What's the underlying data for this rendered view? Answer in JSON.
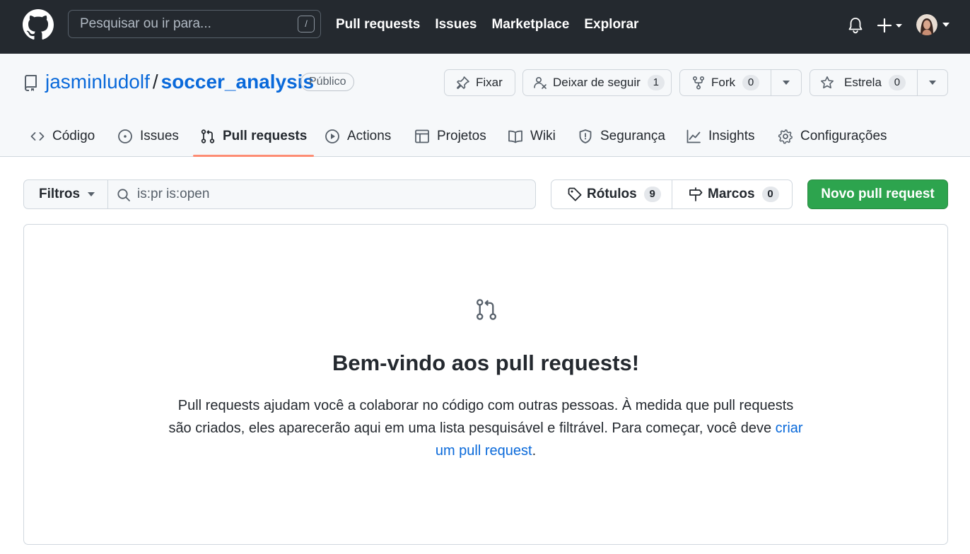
{
  "header": {
    "search_placeholder": "Pesquisar ou ir para...",
    "search_shortcut": "/",
    "nav": [
      "Pull requests",
      "Issues",
      "Marketplace",
      "Explorar"
    ]
  },
  "repo": {
    "owner": "jasminludolf",
    "separator": "/",
    "name": "soccer_analysis",
    "visibility": "Público",
    "actions": {
      "pin_label": "Fixar",
      "unwatch_label": "Deixar de seguir",
      "watch_count": "1",
      "fork_label": "Fork",
      "fork_count": "0",
      "star_label": "Estrela",
      "star_count": "0"
    },
    "tabs": [
      "Código",
      "Issues",
      "Pull requests",
      "Actions",
      "Projetos",
      "Wiki",
      "Segurança",
      "Insights",
      "Configurações"
    ],
    "selected_tab": "Pull requests"
  },
  "toolbar": {
    "filters_label": "Filtros",
    "search_value": "is:pr is:open",
    "labels_label": "Rótulos",
    "labels_count": "9",
    "milestones_label": "Marcos",
    "milestones_count": "0",
    "new_pr_label": "Novo pull request"
  },
  "blankslate": {
    "title": "Bem-vindo aos pull requests!",
    "text_1": "Pull requests ajudam você a colaborar no código com outras pessoas. À medida que pull requests são criados, eles aparecerão aqui em uma lista pesquisável e filtrável. Para começar, você deve ",
    "link_text": "criar um pull request",
    "text_2": "."
  },
  "colors": {
    "header_bg": "#24292f",
    "link": "#0969da",
    "primary_button": "#2da44e",
    "selected_tab_underline": "#fd8c73"
  },
  "icons": [
    "github-logo",
    "bell-icon",
    "plus-icon",
    "repo-icon",
    "pin-icon",
    "eye-slash-icon",
    "fork-icon",
    "star-icon",
    "code-icon",
    "issue-icon",
    "pull-request-icon",
    "play-icon",
    "table-icon",
    "book-icon",
    "shield-icon",
    "graph-icon",
    "gear-icon",
    "search-icon",
    "tag-icon",
    "milestone-icon"
  ]
}
